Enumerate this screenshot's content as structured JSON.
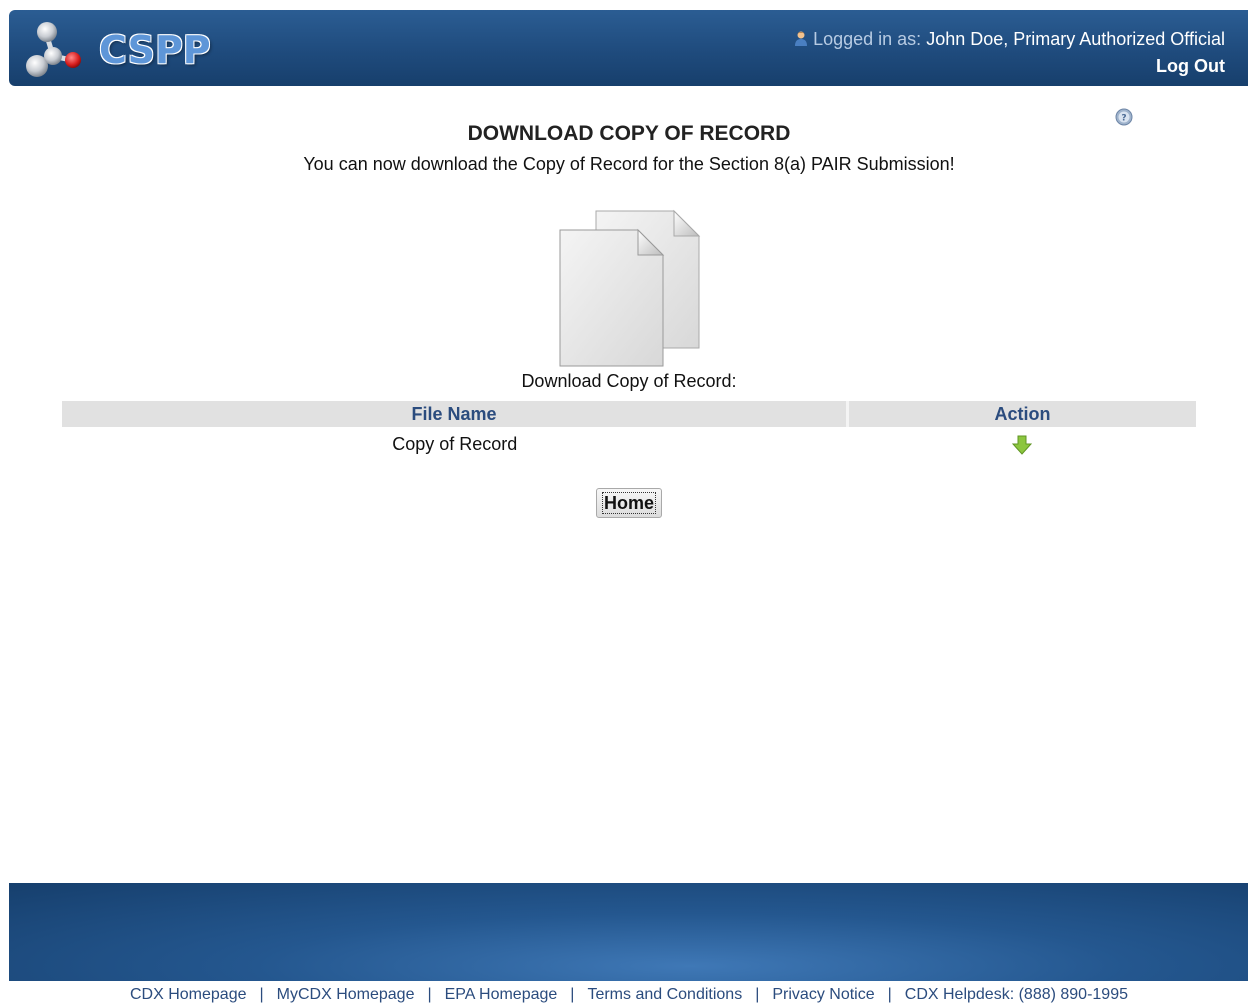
{
  "header": {
    "logo_text": "CSPP",
    "logged_in_label": "Logged in as:",
    "user": "John Doe, Primary Authorized Official",
    "logout_label": "Log Out"
  },
  "main": {
    "title": "DOWNLOAD COPY OF RECORD",
    "subtitle": "You can now download the Copy of Record for the Section 8(a) PAIR Submission!",
    "download_label": "Download Copy of Record:",
    "help_icon": "help-icon",
    "table": {
      "columns": [
        "File Name",
        "Action"
      ],
      "rows": [
        {
          "file_name": "Copy of Record",
          "action_icon": "download-arrow-icon"
        }
      ]
    },
    "home_button": "Home"
  },
  "footer": {
    "links": [
      "CDX Homepage",
      "MyCDX Homepage",
      "EPA Homepage",
      "Terms and Conditions",
      "Privacy Notice",
      "CDX Helpdesk: (888) 890-1995"
    ],
    "separator": "|"
  },
  "colors": {
    "header_bg": "#1f4b7d",
    "header_text": "#ffffff",
    "table_header_bg": "#e1e1e1",
    "table_header_text": "#2b4c7e",
    "download_arrow": "#8cc63f",
    "footer_link": "#2b4c7e"
  }
}
